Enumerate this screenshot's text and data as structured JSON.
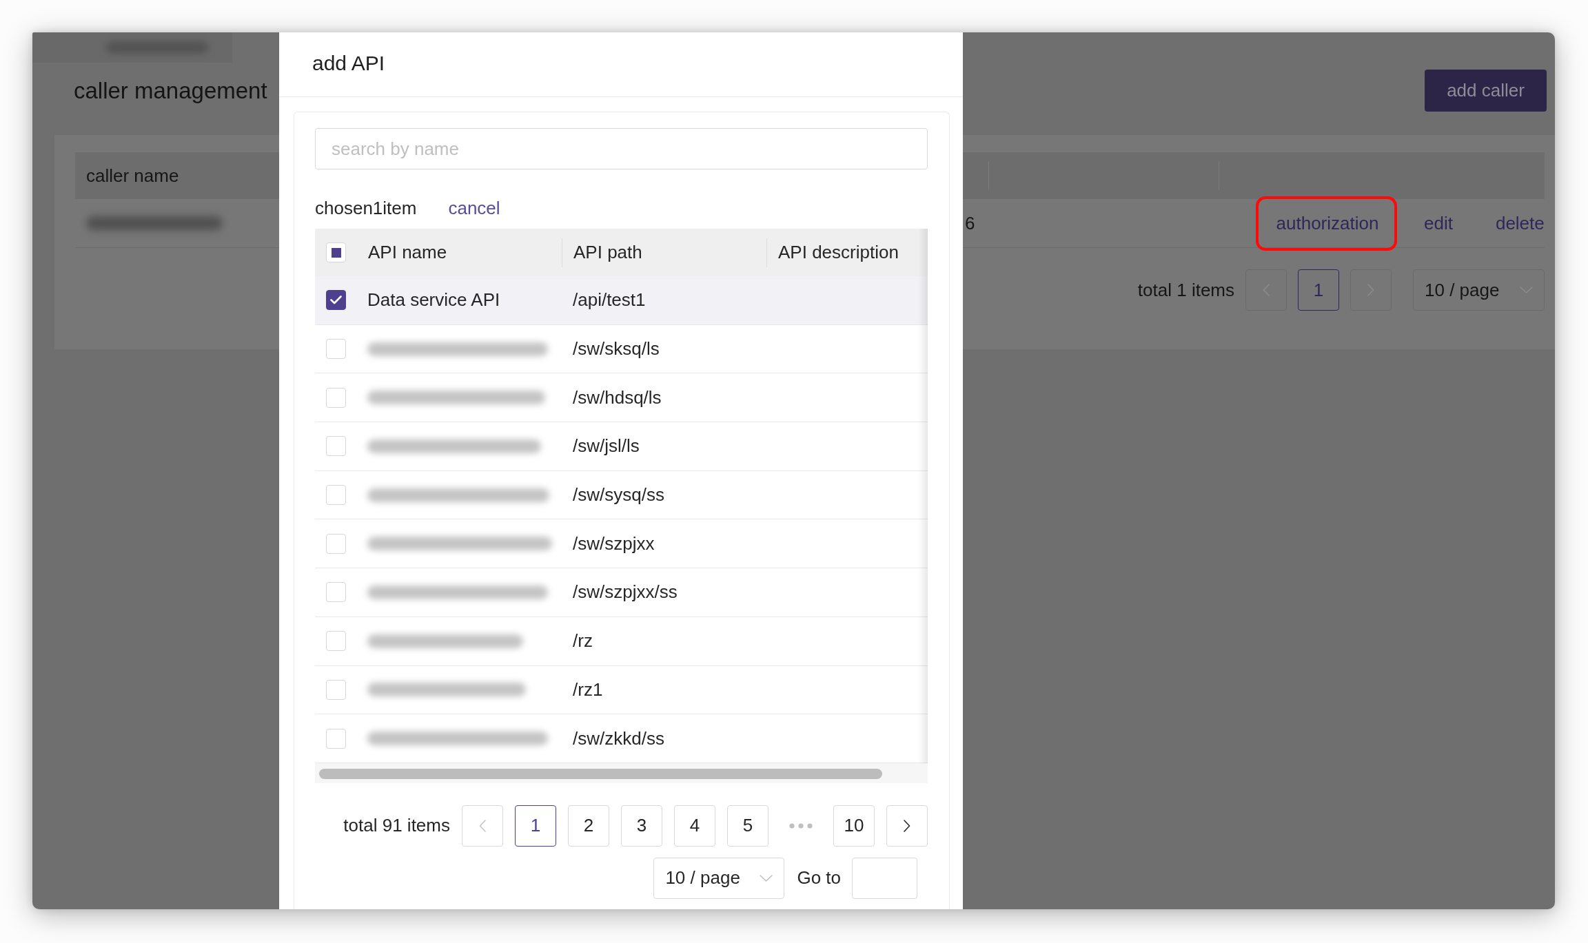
{
  "background_page": {
    "breadcrumb": {
      "blurred": true
    },
    "title": "caller management",
    "add_button": "add caller",
    "table": {
      "columns": [
        "caller name"
      ],
      "rows": [
        {
          "name_blurred": true,
          "column_2": "6",
          "actions": [
            {
              "label": "authorization",
              "highlighted": true
            },
            {
              "label": "edit",
              "highlighted": false
            },
            {
              "label": "delete",
              "highlighted": false
            }
          ]
        }
      ]
    },
    "pagination": {
      "total": "total 1 items",
      "prev_disabled": true,
      "pages": [
        {
          "label": "1",
          "selected": true
        }
      ],
      "next_disabled": true,
      "page_size": "10 / page"
    }
  },
  "dialog": {
    "title": "add API",
    "search": {
      "placeholder": "search by name"
    },
    "selection": {
      "summary": "chosen1item",
      "clear": "cancel"
    },
    "table": {
      "select_all": {
        "indeterminate": true
      },
      "columns": [
        "API name",
        "API path",
        "API description"
      ],
      "rows": [
        {
          "name": "Data service API",
          "name_blurred": false,
          "path": "/api/test1",
          "checked": true
        },
        {
          "name_blurred": true,
          "path": "/sw/sksq/ls",
          "checked": false
        },
        {
          "name_blurred": true,
          "path": "/sw/hdsq/ls",
          "checked": false
        },
        {
          "name_blurred": true,
          "path": "/sw/jsl/ls",
          "checked": false
        },
        {
          "name_blurred": true,
          "path": "/sw/sysq/ss",
          "checked": false
        },
        {
          "name_blurred": true,
          "path": "/sw/szpjxx",
          "checked": false
        },
        {
          "name_blurred": true,
          "path": "/sw/szpjxx/ss",
          "checked": false
        },
        {
          "name_blurred": true,
          "path": "/rz",
          "checked": false
        },
        {
          "name_blurred": true,
          "path": "/rz1",
          "checked": false
        },
        {
          "name_blurred": true,
          "path": "/sw/zkkd/ss",
          "checked": false
        }
      ]
    },
    "pagination": {
      "total": "total 91 items",
      "prev_disabled": true,
      "pages": [
        {
          "label": "1",
          "selected": true
        },
        {
          "label": "2",
          "selected": false
        },
        {
          "label": "3",
          "selected": false
        },
        {
          "label": "4",
          "selected": false
        },
        {
          "label": "5",
          "selected": false
        }
      ],
      "ellipsis": true,
      "last_page": {
        "label": "10",
        "selected": false
      },
      "next_disabled": false,
      "page_size": "10 / page",
      "goto_label": "Go to"
    }
  }
}
